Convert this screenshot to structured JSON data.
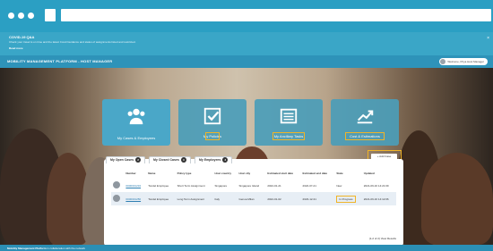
{
  "covid": {
    "title": "COVID-19 Q&A",
    "message": "Check your travel is on time and the latest Covid Guidance and status of assignments listed and restricted.",
    "link": "Read more",
    "close": "×"
  },
  "topbar": {
    "title": "MOBILITY MANAGEMENT PLATFORM - HOST MANAGER",
    "welcome": "Welcome, Priya Host Manager"
  },
  "tiles": [
    {
      "label": "My Cases & Employees"
    },
    {
      "label": "My Policies"
    },
    {
      "label": "My Ancillary Tasks"
    },
    {
      "label": "Cost & Estimations"
    }
  ],
  "tabs": [
    {
      "label": "My Open Cases",
      "count": "2"
    },
    {
      "label": "My Closed Cases",
      "count": "3"
    },
    {
      "label": "My Employees",
      "count": "3"
    }
  ],
  "add_button": "+ Add Case",
  "table": {
    "headers": [
      "",
      "Number",
      "Name",
      "Policy type",
      "Host country",
      "Host city",
      "Estimated start date",
      "Estimated end date",
      "State",
      "Updated"
    ],
    "rows": [
      {
        "number": "0000031234",
        "name": "Tondel Employee",
        "policy": "Short Term Assignment",
        "country": "Singapore",
        "city": "Singapore Island",
        "start": "2022-01-21",
        "end": "2022-07-21",
        "state": "New",
        "updated": "2021-09-16 14:21:09"
      },
      {
        "number": "0000031256",
        "name": "Tondel Employee",
        "policy": "Long Term Assignment",
        "country": "Italy",
        "city": "Genoa Milan",
        "start": "2022-01-02",
        "end": "2023-12-31",
        "state": "In Progress",
        "updated": "2021-09-16 14:12:06"
      }
    ],
    "view_all": "(1-2 of 2) View Results"
  },
  "footer": {
    "brand": "Mobility Management Platform",
    "text": "in collaboration with the network"
  }
}
